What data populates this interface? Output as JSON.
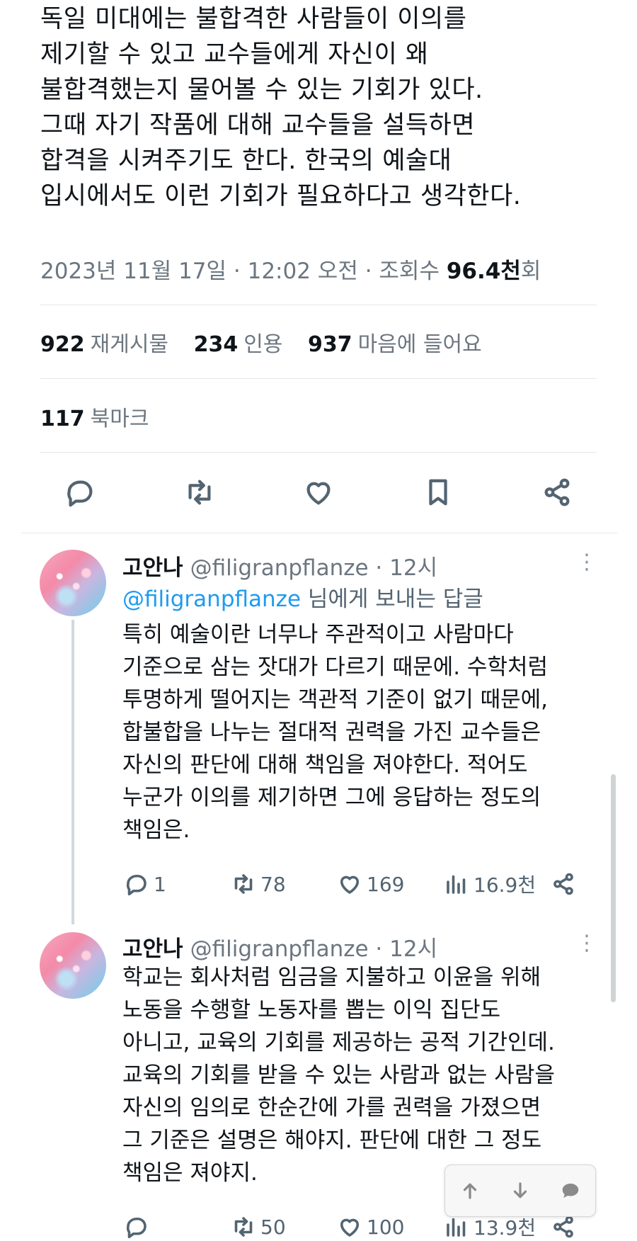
{
  "tweet": {
    "body": "독일 미대에는 불합격한 사람들이 이의를\n제기할 수 있고 교수들에게 자신이 왜\n불합격했는지 물어볼 수 있는 기회가 있다.\n그때 자기 작품에 대해 교수들을 설득하면\n합격을 시켜주기도 한다. 한국의 예술대\n입시에서도 이런 기회가 필요하다고 생각한다.",
    "date": "2023년 11월 17일 · 12:02 오전 · 조회수 ",
    "views": "96.4천",
    "views_suffix": "회"
  },
  "stats": {
    "retweets_count": "922",
    "retweets_label": "재게시물",
    "quotes_count": "234",
    "quotes_label": "인용",
    "likes_count": "937",
    "likes_label": "마음에 들어요",
    "bookmarks_count": "117",
    "bookmarks_label": "북마크"
  },
  "actions": {
    "icons": [
      "reply-icon",
      "retweet-icon",
      "like-icon",
      "bookmark-icon",
      "share-icon"
    ]
  },
  "replies": [
    {
      "name": "고안나",
      "handle_time": "@filigranpflanze · 12시",
      "replying_to_handle": "@filigranpflanze",
      "replying_to_suffix": " 님에게 보내는 답글",
      "text": "특히 예술이란 너무나 주관적이고 사람마다\n기준으로 삼는 잣대가 다르기 때문에. 수학처럼\n투명하게 떨어지는 객관적 기준이 없기 때문에,\n합불합을 나누는 절대적 권력을 가진 교수들은\n자신의 판단에 대해 책임을 져야한다. 적어도\n누군가 이의를 제기하면 그에 응답하는 정도의\n책임은.",
      "replies": "1",
      "retweets": "78",
      "likes": "169",
      "views": "16.9천"
    },
    {
      "name": "고안나",
      "handle_time": "@filigranpflanze · 12시",
      "text": "학교는 회사처럼 임금을 지불하고 이윤을 위해\n노동을 수행할 노동자를 뽑는 이익 집단도\n아니고, 교육의 기회를 제공하는 공적 기간인데.\n교육의 기회를 받을 수 있는 사람과 없는 사람을\n자신의 임의로 한순간에 가를 권력을 가졌으면\n그 기준은 설명은 해야지. 판단에 대한 그 정도\n책임은 져야지.",
      "replies": "",
      "retweets": "50",
      "likes": "100",
      "views": "13.9천"
    }
  ],
  "kebab": "⋮",
  "colors": {
    "link": "#1d9bf0",
    "text": "#0f1419",
    "muted": "#536471",
    "border": "#e3e7ea"
  }
}
